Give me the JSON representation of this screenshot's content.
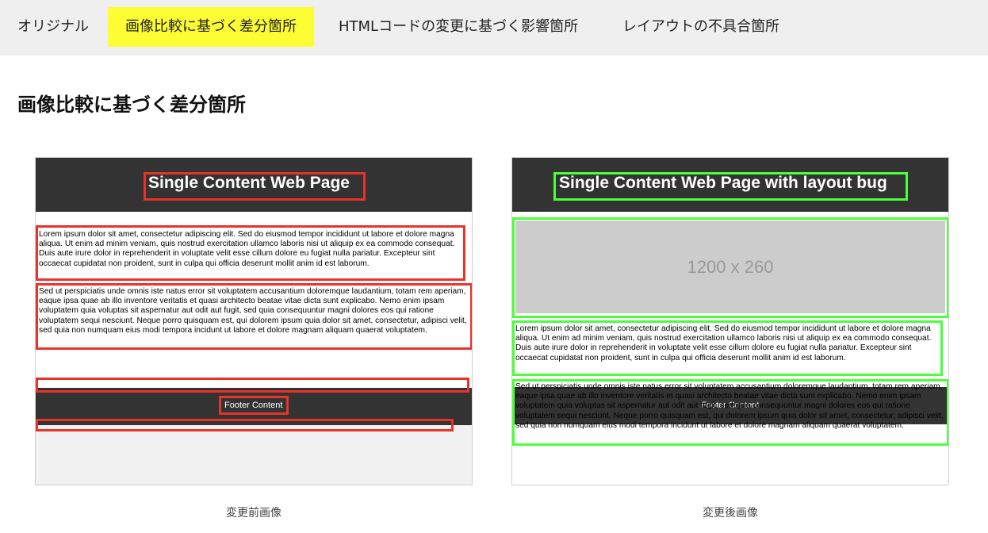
{
  "tabs": [
    {
      "label": "オリジナル"
    },
    {
      "label": "画像比較に基づく差分箇所",
      "active": true
    },
    {
      "label": "HTMLコードの変更に基づく影響箇所"
    },
    {
      "label": "レイアウトの不具合箇所"
    }
  ],
  "page_title": "画像比較に基づく差分箇所",
  "before": {
    "header_title": "Single Content Web Page",
    "paragraph1": "Lorem ipsum dolor sit amet, consectetur adipiscing elit. Sed do eiusmod tempor incididunt ut labore et dolore magna aliqua. Ut enim ad minim veniam, quis nostrud exercitation ullamco laboris nisi ut aliquip ex ea commodo consequat. Duis aute irure dolor in reprehenderit in voluptate velit esse cillum dolore eu fugiat nulla pariatur. Excepteur sint occaecat cupidatat non proident, sunt in culpa qui officia deserunt mollit anim id est laborum.",
    "paragraph2": "Sed ut perspiciatis unde omnis iste natus error sit voluptatem accusantium doloremque laudantium, totam rem aperiam, eaque ipsa quae ab illo inventore veritatis et quasi architecto beatae vitae dicta sunt explicabo. Nemo enim ipsam voluptatem quia voluptas sit aspernatur aut odit aut fugit, sed quia consequuntur magni dolores eos qui ratione voluptatem sequi nesciunt. Neque porro quisquam est, qui dolorem ipsum quia dolor sit amet, consectetur, adipisci velit, sed quia non numquam eius modi tempora incidunt ut labore et dolore magnam aliquam quaerat voluptatem.",
    "footer": "Footer Content",
    "caption": "変更前画像"
  },
  "after": {
    "header_title": "Single Content Web Page with layout bug",
    "image_placeholder": "1200 x 260",
    "paragraph1": "Lorem ipsum dolor sit amet, consectetur adipiscing elit. Sed do eiusmod tempor incididunt ut labore et dolore magna aliqua. Ut enim ad minim veniam, quis nostrud exercitation ullamco laboris nisi ut aliquip ex ea commodo consequat. Duis aute irure dolor in reprehenderit in voluptate velit esse cillum dolore eu fugiat nulla pariatur. Excepteur sint occaecat cupidatat non proident, sunt in culpa qui officia deserunt mollit anim id est laborum.",
    "paragraph2": "Sed ut perspiciatis unde omnis iste natus error sit voluptatem accusantium doloremque laudantium, totam rem aperiam, eaque ipsa quae ab illo inventore veritatis et quasi architecto beatae vitae dicta sunt explicabo. Nemo enim ipsam voluptatem quia voluptas sit aspernatur aut odit aut fugit, sed quia consequuntur magni dolores eos qui ratione voluptatem sequi nesciunt. Neque porro quisquam est, qui dolorem ipsum quia dolor sit amet, consectetur, adipisci velit, sed quia non numquam eius modi tempora incidunt ut labore et dolore magnam aliquam quaerat voluptatem.",
    "footer": "Footer Content",
    "caption": "変更後画像"
  },
  "colors": {
    "active_tab": "#fdfd33",
    "tab_bar": "#efefef",
    "diff_before": "#e8322a",
    "diff_after": "#4cff3a",
    "page_header": "#333333"
  }
}
